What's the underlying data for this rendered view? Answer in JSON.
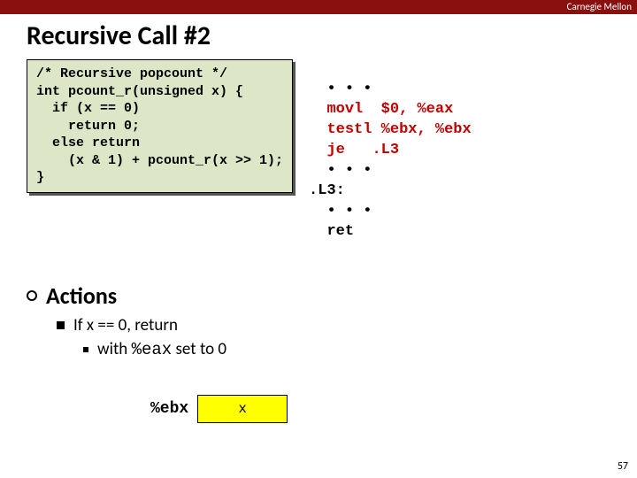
{
  "brand": "Carnegie Mellon",
  "title": "Recursive Call #2",
  "code": "/* Recursive popcount */\nint pcount_r(unsigned x) {\n  if (x == 0)\n    return 0;\n  else return\n    (x & 1) + pcount_r(x >> 1);\n}",
  "asm": {
    "l1": "  • • •",
    "l2a": "  movl  $0, %eax",
    "l2b": "  testl %ebx, %ebx",
    "l2c": "  je   .L3",
    "l3": "  • • •",
    "l4": ".L3:",
    "l5": "  • • •",
    "l6": "  ret"
  },
  "actions_label": "Actions",
  "bullet1": "If x == 0, return",
  "subbullet_pre": "with ",
  "subbullet_mono": "%eax",
  "subbullet_post": " set to 0",
  "reg": {
    "label": "%ebx",
    "value": "x"
  },
  "page": "57"
}
